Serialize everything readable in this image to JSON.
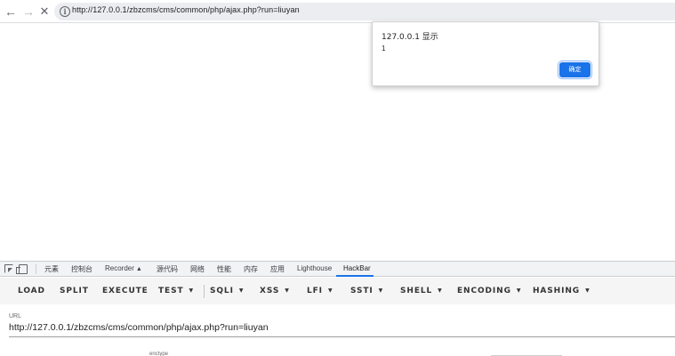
{
  "browser": {
    "url": "http://127.0.0.1/zbzcms/cms/common/php/ajax.php?run=liuyan",
    "icons": {
      "back": "arrow-left-icon",
      "forward": "arrow-right-icon",
      "stop": "close-icon",
      "info": "info-icon"
    }
  },
  "alert": {
    "title": "127.0.0.1 显示",
    "message": "1",
    "ok_label": "确定",
    "accent_color": "#1a73e8"
  },
  "devtools": {
    "tabs": [
      "元素",
      "控制台",
      "Recorder",
      "源代码",
      "网络",
      "性能",
      "内存",
      "应用",
      "Lighthouse",
      "HackBar"
    ],
    "active_tab": "HackBar",
    "recorder_icon": "flask-icon"
  },
  "hackbar": {
    "buttons": [
      "LOAD",
      "SPLIT",
      "EXECUTE"
    ],
    "menus": [
      "TEST",
      "SQLI",
      "XSS",
      "LFI",
      "SSTI",
      "SHELL",
      "ENCODING",
      "HASHING"
    ],
    "url_label": "URL",
    "url_value": "http://127.0.0.1/zbzcms/cms/common/php/ajax.php?run=liuyan",
    "enctype_label": "enctype"
  }
}
